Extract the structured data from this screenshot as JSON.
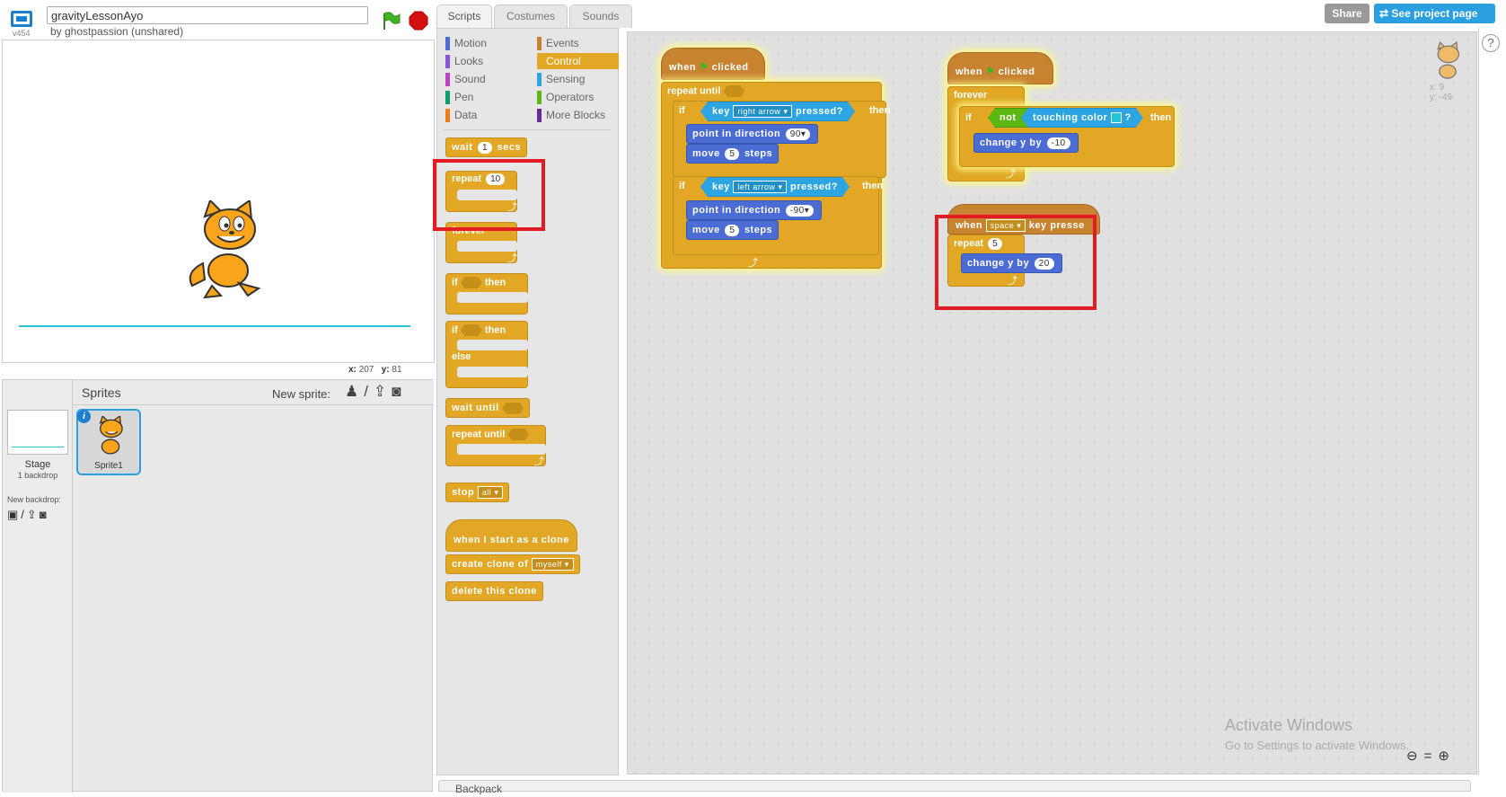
{
  "header": {
    "version": "v454",
    "project_title": "gravityLessonAyo",
    "byline": "by ghostpassion (unshared)",
    "share_label": "Share",
    "see_project_label": "See project page",
    "help_label": "?"
  },
  "stage": {
    "mouse_x_label": "x:",
    "mouse_x": "207",
    "mouse_y_label": "y:",
    "mouse_y": "81"
  },
  "sprite_pane": {
    "stage_label": "Stage",
    "backdrop_count": "1 backdrop",
    "new_backdrop_label": "New backdrop:",
    "sprites_title": "Sprites",
    "new_sprite_label": "New sprite:",
    "sprite_name": "Sprite1",
    "info_label": "i"
  },
  "tabs": [
    "Scripts",
    "Costumes",
    "Sounds"
  ],
  "categories": [
    {
      "label": "Motion",
      "color": "#4a6cd4"
    },
    {
      "label": "Events",
      "color": "#c88330"
    },
    {
      "label": "Looks",
      "color": "#8a55d7"
    },
    {
      "label": "Control",
      "color": "#e1a725",
      "selected": true
    },
    {
      "label": "Sound",
      "color": "#bb42c3"
    },
    {
      "label": "Sensing",
      "color": "#2ca5e2"
    },
    {
      "label": "Pen",
      "color": "#0e9a6c"
    },
    {
      "label": "Operators",
      "color": "#5cb712"
    },
    {
      "label": "Data",
      "color": "#ee7d16"
    },
    {
      "label": "More Blocks",
      "color": "#632d99"
    }
  ],
  "palette": {
    "wait": "wait",
    "wait_num": "1",
    "secs": "secs",
    "repeat": "repeat",
    "repeat_num": "10",
    "forever": "forever",
    "if": "if",
    "then": "then",
    "else": "else",
    "wait_until": "wait until",
    "repeat_until": "repeat until",
    "stop": "stop",
    "stop_opt": "all",
    "clone_hat": "when I start as a clone",
    "create_clone": "create clone of",
    "create_clone_opt": "myself",
    "delete_clone": "delete this clone"
  },
  "scripts": {
    "when": "when",
    "clicked": "clicked",
    "repeat_until": "repeat until",
    "if": "if",
    "key": "key",
    "pressed": "pressed?",
    "then": "then",
    "right_arrow": "right arrow",
    "left_arrow": "left arrow",
    "point_in_direction": "point in direction",
    "dir_right": "90",
    "dir_left": "-90",
    "move": "move",
    "steps": "steps",
    "move_num": "5",
    "forever": "forever",
    "not": "not",
    "touching_color": "touching color",
    "q": "?",
    "change_y_by": "change y by",
    "change_neg": "-10",
    "change_pos": "20",
    "space": "space",
    "key_pressed_trunc": "key presse",
    "repeat": "repeat",
    "repeat_num": "5"
  },
  "sprite_corner": {
    "x": "x: 9",
    "y": "y: -49"
  },
  "watermark": {
    "line1": "Activate Windows",
    "line2": "Go to Settings to activate Windows."
  },
  "backpack_label": "Backpack"
}
